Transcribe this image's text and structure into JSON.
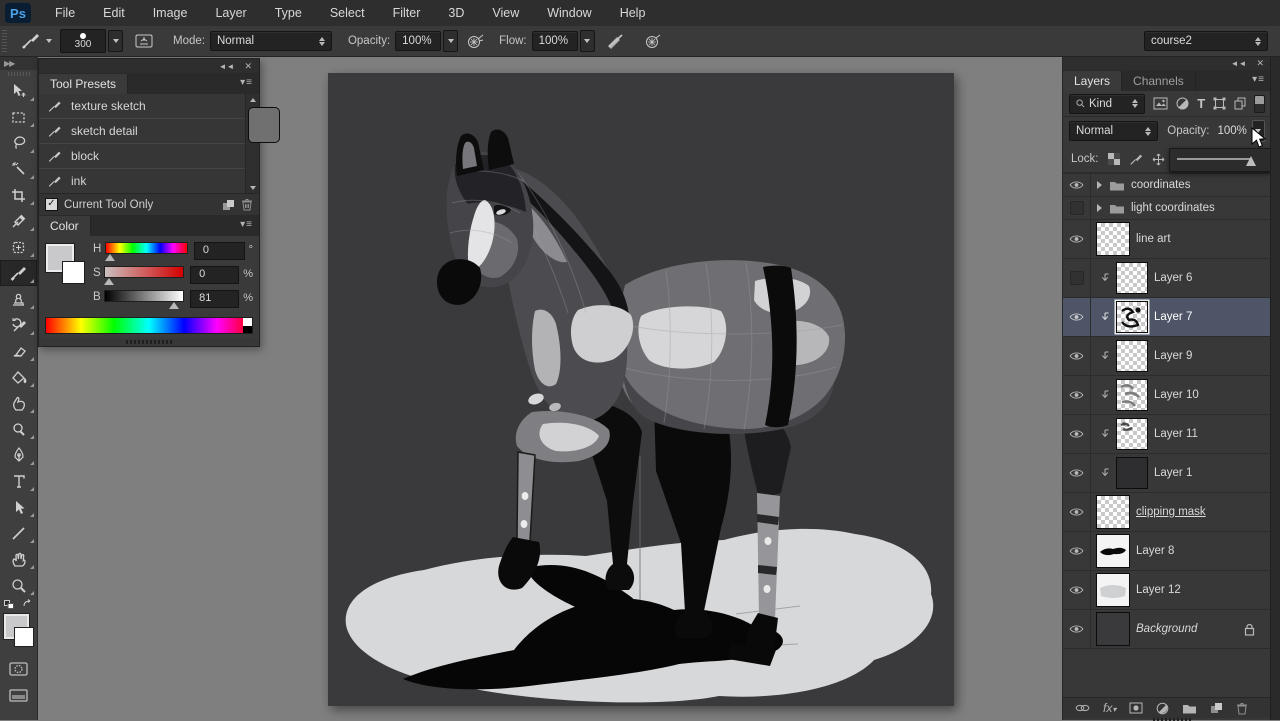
{
  "app": {
    "logo_text": "Ps",
    "workspace": "course2"
  },
  "menu": {
    "items": [
      "File",
      "Edit",
      "Image",
      "Layer",
      "Type",
      "Select",
      "Filter",
      "3D",
      "View",
      "Window",
      "Help"
    ]
  },
  "options": {
    "brush_size": "300",
    "mode_label": "Mode:",
    "mode_value": "Normal",
    "opacity_label": "Opacity:",
    "opacity_value": "100%",
    "flow_label": "Flow:",
    "flow_value": "100%"
  },
  "tool_presets": {
    "title": "Tool Presets",
    "presets": [
      {
        "label": "texture sketch"
      },
      {
        "label": "sketch detail"
      },
      {
        "label": "block"
      },
      {
        "label": "ink"
      }
    ],
    "footer_checkbox": "Current Tool Only"
  },
  "color_panel": {
    "title": "Color",
    "rows": [
      {
        "label": "H",
        "value": "0",
        "unit": "°"
      },
      {
        "label": "S",
        "value": "0",
        "unit": "%"
      },
      {
        "label": "B",
        "value": "81",
        "unit": "%"
      }
    ]
  },
  "layers_panel": {
    "tab_layers": "Layers",
    "tab_channels": "Channels",
    "kind_label": "Kind",
    "blend_mode": "Normal",
    "opacity_label": "Opacity:",
    "opacity_value": "100%",
    "lock_label": "Lock:",
    "items": [
      {
        "name": "coordinates"
      },
      {
        "name": "light coordinates"
      },
      {
        "name": "line art"
      },
      {
        "name": "Layer 6"
      },
      {
        "name": "Layer 7"
      },
      {
        "name": "Layer 9"
      },
      {
        "name": "Layer 10"
      },
      {
        "name": "Layer 11"
      },
      {
        "name": "Layer 1"
      },
      {
        "name": "clipping mask"
      },
      {
        "name": "Layer 8"
      },
      {
        "name": "Layer 12"
      },
      {
        "name": "Background"
      }
    ]
  },
  "colors": {
    "selection": "#4d5566",
    "pasteboard": "#7f7f7f",
    "canvas_bg": "#3a3a3c",
    "panel_bg": "#383838"
  }
}
